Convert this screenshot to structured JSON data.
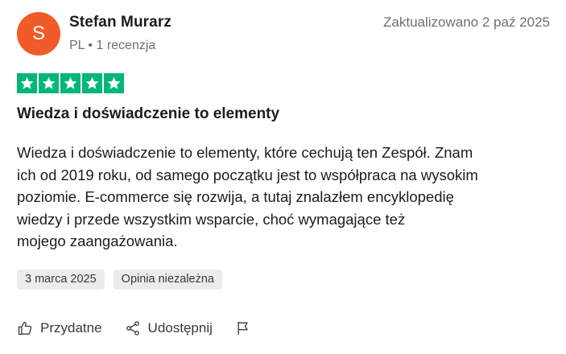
{
  "reviewer": {
    "initial": "S",
    "name": "Stefan Murarz",
    "meta": "PL • 1 recenzja",
    "avatar_color": "#f15a29"
  },
  "review": {
    "updated": "Zaktualizowano 2 paź 2025",
    "rating": 5,
    "star_color": "#00b67a",
    "title": "Wiedza i doświadczenie to elementy",
    "body_lines": [
      "Wiedza i doświadczenie to elementy, które cechują ten Zespół. Znam",
      "ich od 2019 roku, od samego początku jest to współpraca na wysokim",
      "poziomie. E-commerce się rozwija, a tutaj znalazłem encyklopedię",
      "wiedzy i przede wszystkim wsparcie, choć wymagające też",
      "mojego zaangażowania."
    ],
    "experience_date": "3 marca 2025",
    "badge": "Opinia niezależna"
  },
  "actions": {
    "helpful_label": "Przydatne",
    "share_label": "Udostępnij",
    "helpful_icon": "thumbs-up-icon",
    "share_icon": "share-icon",
    "report_icon": "flag-icon"
  }
}
